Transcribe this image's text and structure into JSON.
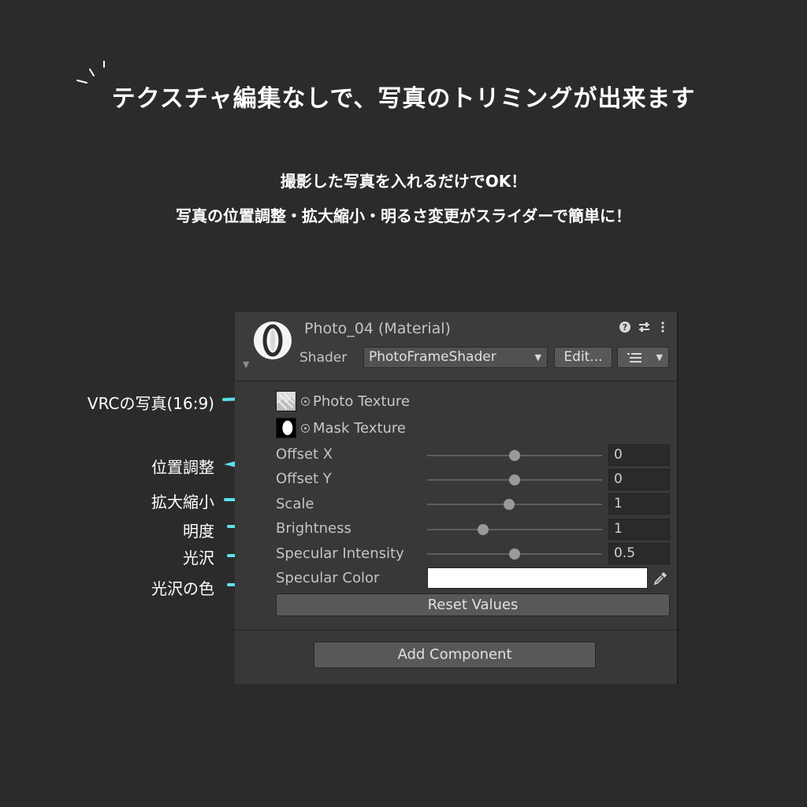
{
  "heading": {
    "title": "テクスチャ編集なしで、写真のトリミングが出来ます",
    "line1": "撮影した写真を入れるだけでOK！",
    "line2": "写真の位置調整・拡大縮小・明るさ変更がスライダーで簡単に！"
  },
  "annotations": {
    "photo": "VRCの写真(16:9)",
    "position": "位置調整",
    "scale": "拡大縮小",
    "brightness": "明度",
    "gloss": "光沢",
    "gloss_color": "光沢の色"
  },
  "inspector": {
    "material_title": "Photo_04 (Material)",
    "shader_label": "Shader",
    "shader_value": "PhotoFrameShader",
    "edit_label": "Edit...",
    "textures": [
      {
        "label": "Photo Texture"
      },
      {
        "label": "Mask Texture"
      }
    ],
    "properties": [
      {
        "label": "Offset X",
        "value": "0",
        "slider": 0.5
      },
      {
        "label": "Offset Y",
        "value": "0",
        "slider": 0.5
      },
      {
        "label": "Scale",
        "value": "1",
        "slider": 0.47
      },
      {
        "label": "Brightness",
        "value": "1",
        "slider": 0.32
      },
      {
        "label": "Specular Intensity",
        "value": "0.5",
        "slider": 0.5
      }
    ],
    "specular_color_label": "Specular Color",
    "specular_color": "#ffffff",
    "reset_label": "Reset Values",
    "add_component_label": "Add Component"
  },
  "colors": {
    "background": "#2b2b2b",
    "panel": "#383838",
    "accent_line": "#5ee0ee"
  },
  "icons": [
    "help-icon",
    "preset-sliders-icon",
    "more-vert-icon",
    "dropdown-arrow-icon",
    "list-icon",
    "eyedropper-icon",
    "foldout-arrow-icon"
  ]
}
